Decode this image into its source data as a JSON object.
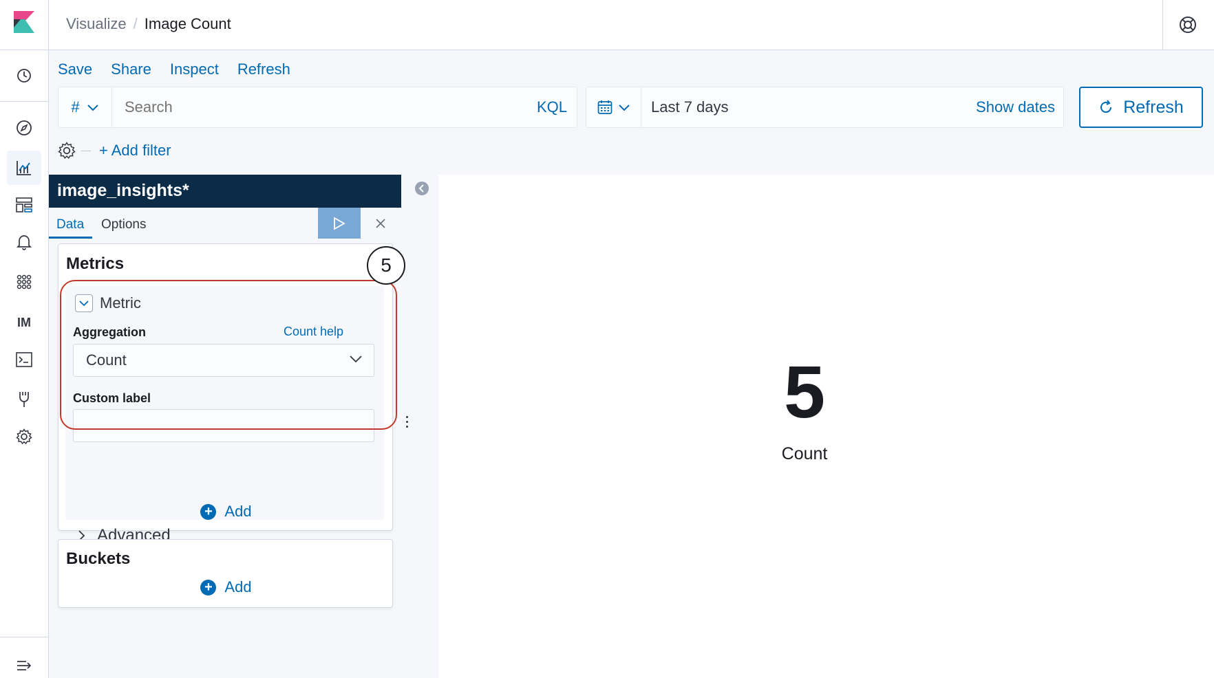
{
  "header": {
    "breadcrumbs": [
      "Visualize",
      "Image Count"
    ],
    "breadcrumb_separator": "/"
  },
  "sidenav": {
    "items": [
      "recently-viewed-icon",
      "discover-icon",
      "visualize-icon",
      "dashboard-icon",
      "alerting-icon",
      "apps-icon",
      "IM",
      "dev-tools-icon",
      "monitoring-icon",
      "settings-icon"
    ],
    "im_label": "IM",
    "active_item": "visualize-icon"
  },
  "top_menu": {
    "save": "Save",
    "share": "Share",
    "inspect": "Inspect",
    "refresh": "Refresh"
  },
  "query": {
    "lang_symbol": "#",
    "placeholder": "Search",
    "lang_label": "KQL"
  },
  "time": {
    "range": "Last 7 days",
    "show_dates": "Show dates",
    "refresh_button": "Refresh"
  },
  "filters": {
    "add_filter": "+ Add filter"
  },
  "editor": {
    "index_pattern": "image_insights*",
    "tabs": [
      "Data",
      "Options"
    ],
    "active_tab": "Data",
    "metrics": {
      "title": "Metrics",
      "agg_title": "Metric",
      "aggregation_label": "Aggregation",
      "help_link": "Count help",
      "aggregation_value": "Count",
      "custom_label_label": "Custom label",
      "custom_label_value": "",
      "advanced": "Advanced",
      "add": "Add"
    },
    "buckets": {
      "title": "Buckets",
      "add": "Add"
    }
  },
  "annotation": {
    "step_number": "5",
    "outline_color": "#c0392b"
  },
  "visualization": {
    "value": "5",
    "label": "Count"
  },
  "colors": {
    "accent": "#006bb4",
    "index_header_bg": "#0b2b46",
    "apply_button_bg": "#79a8d7"
  }
}
